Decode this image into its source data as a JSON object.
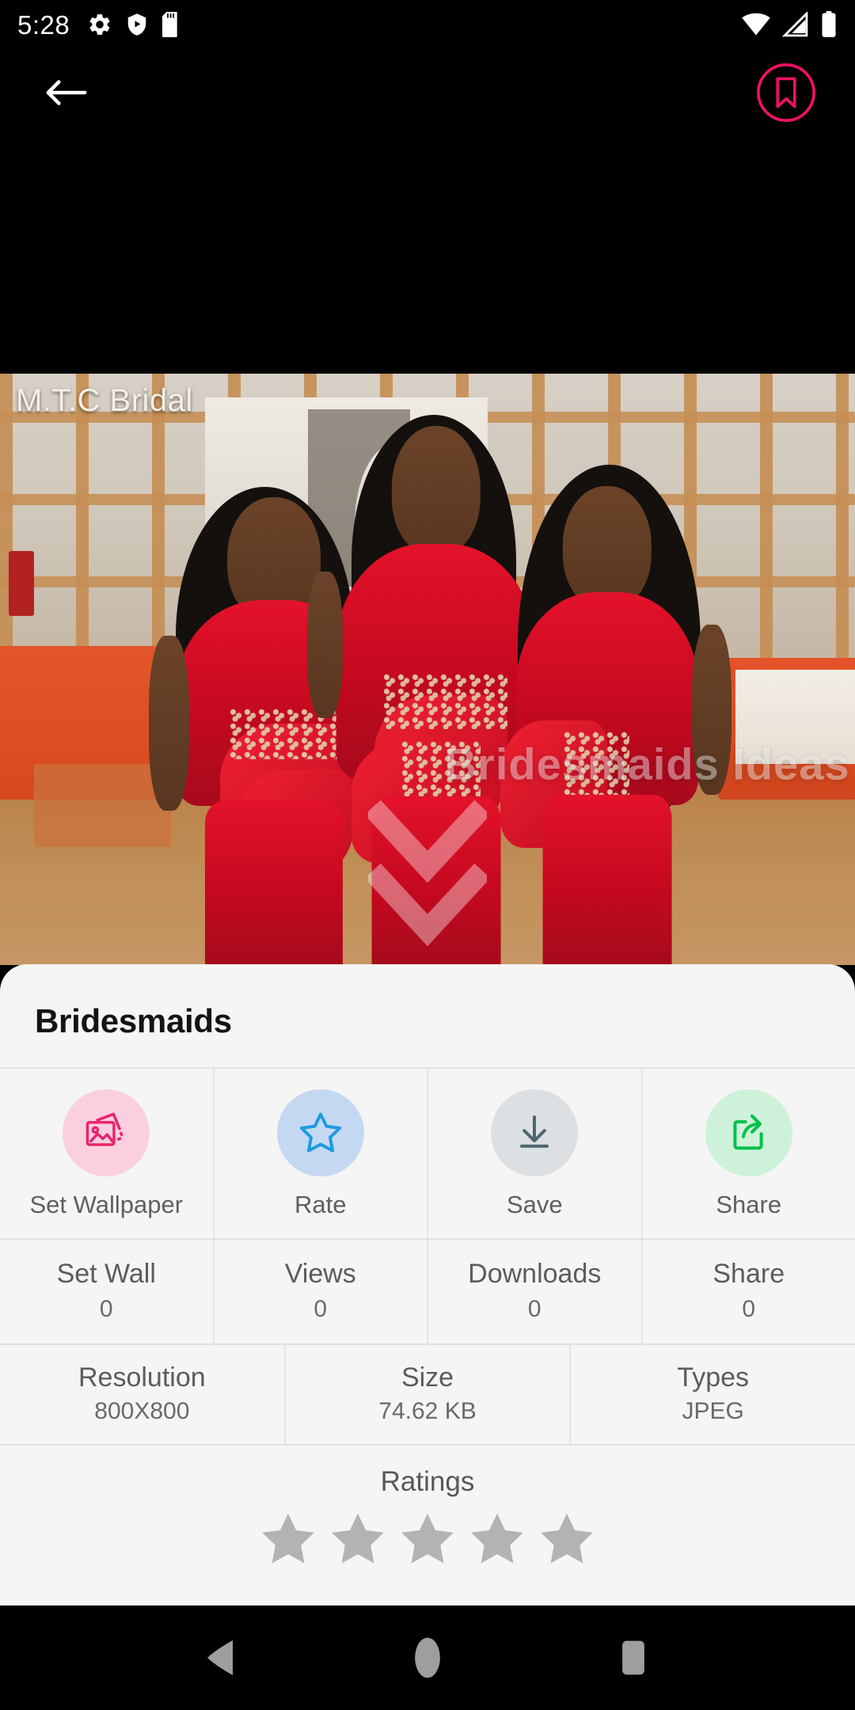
{
  "status_bar": {
    "time": "5:28",
    "left_icons": [
      "gear-icon",
      "play-protect-icon",
      "sd-card-icon"
    ],
    "right_icons": [
      "wifi-icon",
      "cellular-signal-icon",
      "battery-icon"
    ]
  },
  "app_bar": {
    "back_icon": "back-arrow-icon",
    "bookmark_icon": "bookmark-icon",
    "bookmark_color": "#ED1164"
  },
  "photo": {
    "brand_watermark": "M.T.C Bridal",
    "center_watermark": "Bridesmaids Ideas",
    "scroll_hint_icon": "double-chevron-down-icon",
    "alt": "Three women wearing red bridesmaid gowns standing in a room with a wooden lattice wall"
  },
  "sheet": {
    "title": "Bridesmaids",
    "actions": [
      {
        "label": "Set Wallpaper",
        "icon": "image-gallery-icon",
        "circle_color": "#FBD0DE",
        "icon_color": "#E8256E"
      },
      {
        "label": "Rate",
        "icon": "star-outline-icon",
        "circle_color": "#C5D8F2",
        "icon_color": "#1C9BE0"
      },
      {
        "label": "Save",
        "icon": "download-icon",
        "circle_color": "#DCE0E2",
        "icon_color": "#4C6670"
      },
      {
        "label": "Share",
        "icon": "share-export-icon",
        "circle_color": "#CDF2D9",
        "icon_color": "#00C04B"
      }
    ],
    "stats": [
      {
        "label": "Set Wall",
        "value": "0"
      },
      {
        "label": "Views",
        "value": "0"
      },
      {
        "label": "Downloads",
        "value": "0"
      },
      {
        "label": "Share",
        "value": "0"
      }
    ],
    "meta": [
      {
        "label": "Resolution",
        "value": "800X800"
      },
      {
        "label": "Size",
        "value": "74.62 KB"
      },
      {
        "label": "Types",
        "value": "JPEG"
      }
    ],
    "ratings": {
      "title": "Ratings",
      "star_count": 5,
      "filled": 0,
      "empty_color": "#B3B3B3"
    }
  },
  "nav_bar": {
    "back_icon": "nav-back-triangle-icon",
    "home_icon": "nav-home-circle-icon",
    "recents_icon": "nav-recents-square-icon"
  }
}
